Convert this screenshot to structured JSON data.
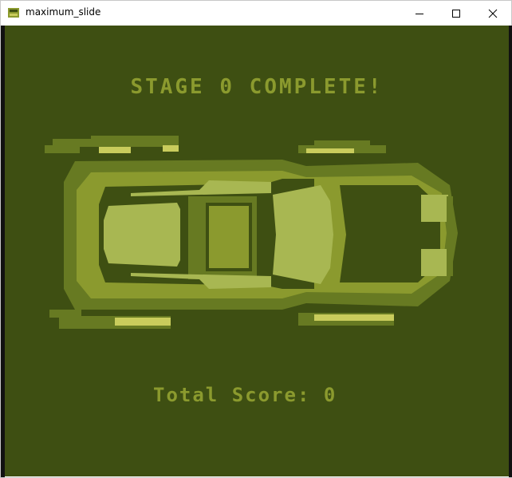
{
  "window": {
    "title": "maximum_slide",
    "controls": [
      "minimize",
      "maximize",
      "close"
    ]
  },
  "game": {
    "stage_text": "STAGE 0 COMPLETE!",
    "score_text": "Total Score: 0",
    "palette": {
      "darkest": "#3e4f12",
      "dark": "#677a22",
      "light": "#8b9a2e",
      "lightest": "#a8b752",
      "highlight": "#c9cc5c"
    }
  }
}
